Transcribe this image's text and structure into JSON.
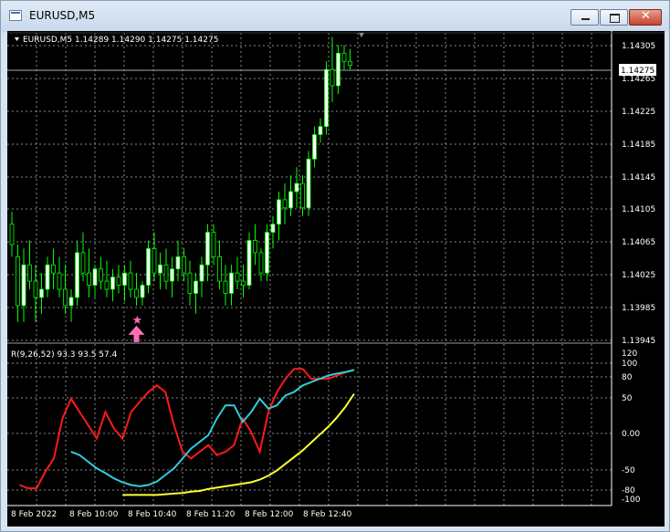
{
  "window": {
    "title": "EURUSD,M5"
  },
  "main": {
    "symbol_info": "EURUSD,M5  1.14289 1.14290 1.14275 1.14275",
    "current_price_label": "1.14275",
    "price_ticks": [
      "1.14305",
      "1.14265",
      "1.14225",
      "1.14185",
      "1.14145",
      "1.14105",
      "1.14065",
      "1.14025",
      "1.13985",
      "1.13945"
    ]
  },
  "indicator": {
    "label": "R(9,26,52) 93.3 93.5 57.4",
    "ticks": [
      "120",
      "100",
      "80",
      "50",
      "0.00",
      "-50",
      "-80",
      "-100"
    ]
  },
  "time_axis": [
    "8 Feb 2022",
    "8 Feb 10:00",
    "8 Feb 10:40",
    "8 Feb 11:20",
    "8 Feb 12:00",
    "8 Feb 12:40"
  ],
  "colors": {
    "background": "#000000",
    "grid": "#8a8a8a",
    "up_candle": "#ffffff",
    "down_candle": "#000000",
    "wick": "#00ff00",
    "red_line": "#ff1a1a",
    "cyan_line": "#33ccdd",
    "yellow_line": "#ffff33",
    "signal_arrow": "#ff6eb4"
  },
  "chart_data": [
    {
      "type": "candlestick",
      "x_labels": [
        "8 Feb 2022",
        "8 Feb 10:00",
        "8 Feb 10:40",
        "8 Feb 11:20",
        "8 Feb 12:00",
        "8 Feb 12:40"
      ],
      "ylim": [
        1.13935,
        1.14315
      ],
      "ohlc": [
        [
          1.1408,
          1.14095,
          1.1404,
          1.14055
        ],
        [
          1.1404,
          1.14055,
          1.1396,
          1.1398
        ],
        [
          1.1398,
          1.1405,
          1.1396,
          1.1403
        ],
        [
          1.1403,
          1.1406,
          1.14,
          1.1401
        ],
        [
          1.1401,
          1.1403,
          1.1396,
          1.1399
        ],
        [
          1.1399,
          1.1402,
          1.1397,
          1.14
        ],
        [
          1.14,
          1.1404,
          1.1399,
          1.1403
        ],
        [
          1.1403,
          1.1405,
          1.14,
          1.1402
        ],
        [
          1.1402,
          1.1404,
          1.1399,
          1.14
        ],
        [
          1.14,
          1.1403,
          1.1397,
          1.1398
        ],
        [
          1.1398,
          1.14,
          1.1396,
          1.1399
        ],
        [
          1.1399,
          1.1406,
          1.1398,
          1.14045
        ],
        [
          1.14045,
          1.1407,
          1.1401,
          1.1402
        ],
        [
          1.1402,
          1.1405,
          1.1399,
          1.14005
        ],
        [
          1.14005,
          1.1403,
          1.1399,
          1.14025
        ],
        [
          1.14025,
          1.1404,
          1.14,
          1.1401
        ],
        [
          1.1401,
          1.14035,
          1.1399,
          1.14
        ],
        [
          1.14,
          1.14025,
          1.13985,
          1.14015
        ],
        [
          1.14015,
          1.1403,
          1.13995,
          1.14005
        ],
        [
          1.14005,
          1.1403,
          1.13985,
          1.1402
        ],
        [
          1.1402,
          1.14035,
          1.1399,
          1.14
        ],
        [
          1.14,
          1.1402,
          1.1398,
          1.1399
        ],
        [
          1.1399,
          1.1401,
          1.1398,
          1.14005
        ],
        [
          1.14005,
          1.1406,
          1.13995,
          1.1405
        ],
        [
          1.1405,
          1.1407,
          1.1401,
          1.1402
        ],
        [
          1.1402,
          1.14045,
          1.14,
          1.1403
        ],
        [
          1.1403,
          1.1405,
          1.14,
          1.1401
        ],
        [
          1.1401,
          1.1404,
          1.1399,
          1.14025
        ],
        [
          1.14025,
          1.1406,
          1.1401,
          1.1404
        ],
        [
          1.1404,
          1.1405,
          1.1401,
          1.1402
        ],
        [
          1.1402,
          1.14035,
          1.1398,
          1.13995
        ],
        [
          1.13995,
          1.1402,
          1.1397,
          1.1401
        ],
        [
          1.1401,
          1.1404,
          1.1399,
          1.1403
        ],
        [
          1.1403,
          1.1408,
          1.1401,
          1.1407
        ],
        [
          1.1407,
          1.1408,
          1.1403,
          1.1404
        ],
        [
          1.1404,
          1.1406,
          1.14,
          1.1401
        ],
        [
          1.1401,
          1.1403,
          1.1398,
          1.13995
        ],
        [
          1.13995,
          1.1403,
          1.1398,
          1.1402
        ],
        [
          1.1402,
          1.1404,
          1.14,
          1.1401
        ],
        [
          1.1401,
          1.1403,
          1.1399,
          1.14005
        ],
        [
          1.14005,
          1.1407,
          1.14,
          1.1406
        ],
        [
          1.1406,
          1.1408,
          1.1403,
          1.14045
        ],
        [
          1.14045,
          1.1405,
          1.1401,
          1.1402
        ],
        [
          1.1402,
          1.1408,
          1.1401,
          1.1407
        ],
        [
          1.1407,
          1.1409,
          1.1405,
          1.1408
        ],
        [
          1.1408,
          1.1412,
          1.1406,
          1.1411
        ],
        [
          1.1411,
          1.1413,
          1.1408,
          1.141
        ],
        [
          1.141,
          1.1414,
          1.1409,
          1.1412
        ],
        [
          1.1412,
          1.1415,
          1.141,
          1.1413
        ],
        [
          1.1413,
          1.1414,
          1.1409,
          1.141
        ],
        [
          1.141,
          1.1417,
          1.1409,
          1.1416
        ],
        [
          1.1416,
          1.142,
          1.1415,
          1.1419
        ],
        [
          1.1419,
          1.1421,
          1.1418,
          1.142
        ],
        [
          1.142,
          1.1428,
          1.1419,
          1.1427
        ],
        [
          1.1427,
          1.1431,
          1.1423,
          1.1425
        ],
        [
          1.1425,
          1.143,
          1.1424,
          1.1429
        ],
        [
          1.1429,
          1.143,
          1.1427,
          1.1428
        ],
        [
          1.1428,
          1.14295,
          1.1427,
          1.14275
        ]
      ],
      "signal": {
        "index": 21,
        "type": "buy-arrow"
      }
    },
    {
      "type": "line",
      "ylim": [
        -100,
        120
      ],
      "series": [
        {
          "color": "#ff1a1a",
          "values": [
            -80,
            -85,
            -85,
            -60,
            -40,
            20,
            50,
            30,
            10,
            -10,
            30,
            5,
            -10,
            30,
            45,
            60,
            70,
            60,
            10,
            -30,
            -40,
            -30,
            -20,
            -35,
            -30,
            -20,
            20,
            0,
            -30,
            30,
            60,
            80,
            95,
            95,
            80,
            80,
            80,
            85,
            90,
            93.3
          ]
        },
        {
          "color": "#33ccdd",
          "values": [
            -30,
            -35,
            -45,
            -55,
            -62,
            -70,
            -76,
            -80,
            -82,
            -80,
            -75,
            -65,
            -55,
            -40,
            -25,
            -15,
            -5,
            20,
            40,
            40,
            15,
            30,
            50,
            35,
            40,
            55,
            60,
            70,
            75,
            80,
            85,
            88,
            90,
            93.5
          ]
        },
        {
          "color": "#ffff33",
          "values": [
            -95,
            -95,
            -95,
            -95,
            -95,
            -94,
            -93,
            -92,
            -90,
            -89,
            -86,
            -84,
            -82,
            -80,
            -78,
            -76,
            -72,
            -66,
            -58,
            -48,
            -38,
            -28,
            -16,
            -4,
            8,
            22,
            38,
            57.4
          ]
        }
      ]
    }
  ]
}
